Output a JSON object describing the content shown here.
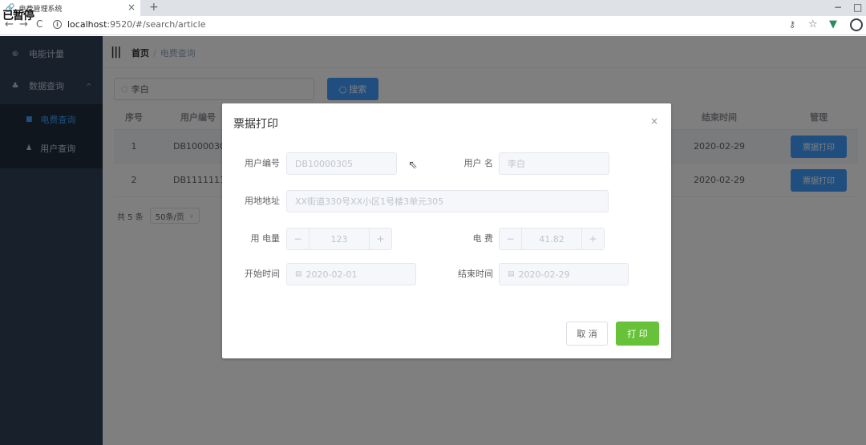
{
  "browser": {
    "tab_title": "电费管理系统",
    "tab_close": "×",
    "new_tab": "+",
    "minimize": "−",
    "restore": "□",
    "url_host": "localhost",
    "url_path": ":9520/#/search/article",
    "paused_label": "已暂停"
  },
  "sidebar": {
    "items": [
      {
        "label": "电能计量",
        "icon": "plus-circle-icon"
      },
      {
        "label": "数据查询",
        "icon": "sitemap-icon",
        "expanded": true
      }
    ],
    "sub_items": [
      {
        "label": "电费查询",
        "active": true
      },
      {
        "label": "用户查询",
        "active": false
      }
    ]
  },
  "navbar": {
    "breadcrumb_home": "首页",
    "breadcrumb_sep": "/",
    "breadcrumb_current": "电费查询"
  },
  "search": {
    "value": "李白",
    "button_label": "搜索"
  },
  "table": {
    "columns": [
      "序号",
      "用户编号",
      "结束时间",
      "管理"
    ],
    "rows": [
      {
        "index": "1",
        "user_id": "DB10000305",
        "end_time": "2020-02-29",
        "action": "票据打印"
      },
      {
        "index": "2",
        "user_id": "DB111111111",
        "end_time": "2020-02-29",
        "action": "票据打印"
      }
    ]
  },
  "pagination": {
    "total": "共 5 条",
    "page_size": "50条/页"
  },
  "dialog": {
    "title": "票据打印",
    "close": "×",
    "fields": {
      "user_id_label": "用户编号",
      "user_id_value": "DB10000305",
      "user_name_label": "用户 名",
      "user_name_value": "李白",
      "address_label": "用地地址",
      "address_value": "XX街道330号XX小区1号楼3单元305",
      "usage_label": "用 电量",
      "usage_value": "123",
      "fee_label": "电 费",
      "fee_value": "41.82",
      "start_label": "开始时间",
      "start_value": "2020-02-01",
      "end_label": "结束时间",
      "end_value": "2020-02-29"
    },
    "stepper_minus": "−",
    "stepper_plus": "+",
    "cancel_label": "取 消",
    "ok_label": "打 印"
  },
  "colors": {
    "primary": "#409eff",
    "success": "#67c23a",
    "sidebar_bg": "#304156"
  }
}
